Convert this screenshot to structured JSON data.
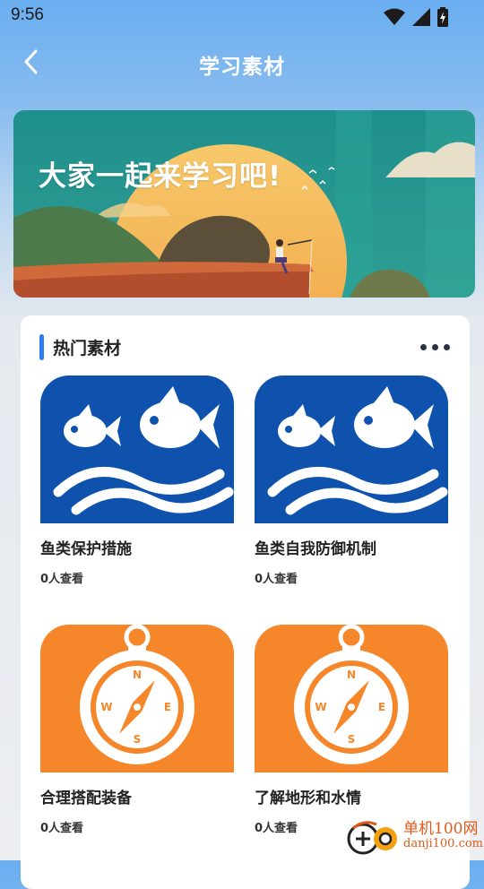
{
  "status_bar": {
    "time": "9:56"
  },
  "header": {
    "title": "学习素材"
  },
  "banner": {
    "text": "大家一起来学习吧!"
  },
  "section": {
    "title": "热门素材"
  },
  "items": [
    {
      "title": "鱼类保护措施",
      "views": "0人查看",
      "icon": "fish-icon",
      "color": "#0f52ae"
    },
    {
      "title": "鱼类自我防御机制",
      "views": "0人查看",
      "icon": "fish-icon",
      "color": "#0f52ae"
    },
    {
      "title": "合理搭配装备",
      "views": "0人查看",
      "icon": "compass-icon",
      "color": "#f5862a"
    },
    {
      "title": "了解地形和水情",
      "views": "0人查看",
      "icon": "compass-icon",
      "color": "#f5862a"
    }
  ],
  "watermark": {
    "name": "单机100网",
    "url": "danji100.com"
  },
  "colors": {
    "accent": "#2f7af5",
    "fish_bg": "#0f52ae",
    "compass_bg": "#f5862a"
  }
}
